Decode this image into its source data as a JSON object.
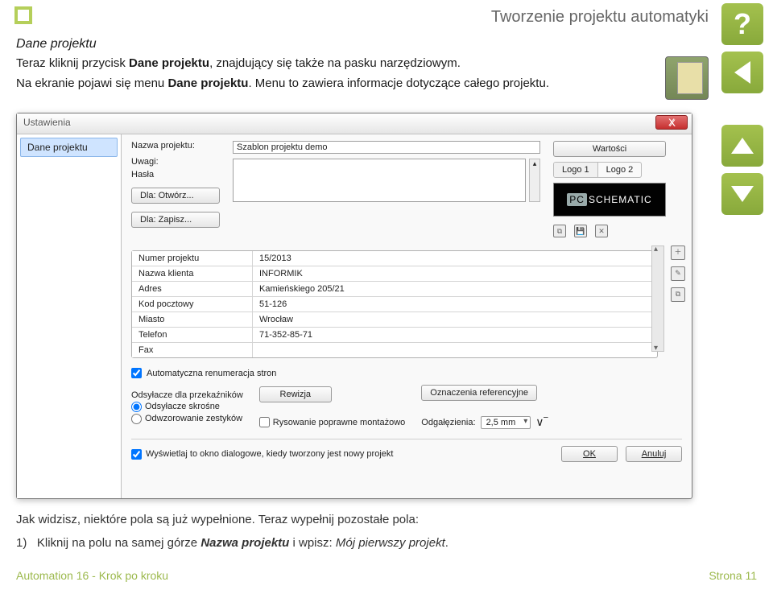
{
  "header": {
    "title": "Tworzenie projektu automatyki"
  },
  "intro": {
    "section_title": "Dane projektu",
    "p1_a": "Teraz kliknij przycisk ",
    "p1_b": "Dane projektu",
    "p1_c": ", znajdujący się także na pasku narzędziowym.",
    "p2_a": "Na ekranie pojawi się menu ",
    "p2_b": "Dane projektu",
    "p2_c": ". Menu to zawiera informacje dotyczące całego projektu."
  },
  "dialog": {
    "title": "Ustawienia",
    "close_x": "X",
    "sidebar": {
      "item0": "Dane projektu"
    },
    "labels": {
      "project_name": "Nazwa projektu:",
      "remarks": "Uwagi:",
      "passwords": "Hasła"
    },
    "values": {
      "project_name": "Szablon projektu demo"
    },
    "buttons": {
      "dla_open": "Dla: Otwórz...",
      "dla_save": "Dla: Zapisz...",
      "wartosci": "Wartości",
      "rewizja": "Rewizja",
      "ozn_ref": "Oznaczenia referencyjne",
      "ok": "OK",
      "anuluj": "Anuluj"
    },
    "logo": {
      "tab1": "Logo 1",
      "tab2": "Logo 2",
      "brand_a": "PC",
      "brand_b": "SCHEMATIC"
    },
    "fields": [
      {
        "label": "Numer projektu",
        "value": "15/2013"
      },
      {
        "label": "Nazwa klienta",
        "value": "INFORMIK"
      },
      {
        "label": "Adres",
        "value": "Kamieńskiego 205/21"
      },
      {
        "label": "Kod pocztowy",
        "value": "51-126"
      },
      {
        "label": "Miasto",
        "value": "Wrocław"
      },
      {
        "label": "Telefon",
        "value": "71-352-85-71"
      },
      {
        "label": "Fax",
        "value": ""
      }
    ],
    "options": {
      "auto_renum": "Automatyczna renumeracja stron",
      "ods_group": "Odsyłacze dla przekaźników",
      "ods_skrosne": "Odsyłacze skrośne",
      "odwz": "Odwzorowanie zestyków",
      "rys_poprawne": "Rysowanie poprawne montażowo",
      "odgalezenia": "Odgałęzienia:",
      "odgalezenia_val": "2,5 mm",
      "show_on_new": "Wyświetlaj to okno dialogowe, kiedy tworzony jest nowy projekt"
    }
  },
  "after": {
    "line1": "Jak widzisz, niektóre pola są już wypełnione. Teraz wypełnij pozostałe pola:",
    "bullet_no": "1)",
    "bullet_a": "Kliknij na polu na samej górze ",
    "bullet_b": "Nazwa projektu",
    "bullet_c": " i wpisz: ",
    "bullet_d": "Mój pierwszy projekt",
    "bullet_e": "."
  },
  "footer": {
    "left": "Automation 16 - Krok po kroku",
    "right": "Strona 11"
  }
}
